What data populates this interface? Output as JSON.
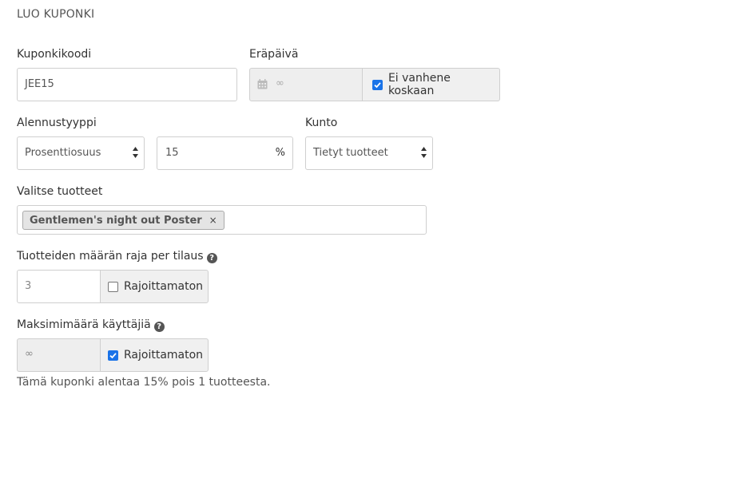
{
  "page_title": "LUO KUPONKI",
  "coupon_code": {
    "label": "Kuponkikoodi",
    "value": "JEE15"
  },
  "expiry": {
    "label": "Eräpäivä",
    "value": "∞",
    "checkbox_label": "Ei vanhene koskaan",
    "checked": true
  },
  "discount_type": {
    "label": "Alennustyyppi",
    "selected": "Prosenttiosuus",
    "amount": "15",
    "unit": "%"
  },
  "condition": {
    "label": "Kunto",
    "selected": "Tietyt tuotteet"
  },
  "products": {
    "label": "Valitse tuotteet",
    "selected_tags": [
      "Gentlemen's night out Poster"
    ],
    "remove_symbol": "×"
  },
  "quantity_limit": {
    "label": "Tuotteiden määrän raja per tilaus",
    "help_icon": "?",
    "value": "3",
    "checkbox_label": "Rajoittamaton",
    "checked": false
  },
  "max_users": {
    "label": "Maksimimäärä käyttäjiä",
    "help_icon": "?",
    "value": "∞",
    "checkbox_label": "Rajoittamaton",
    "checked": true
  },
  "summary": "Tämä kuponki alentaa 15% pois 1 tuotteesta.",
  "colors": {
    "checkbox_checked": "#1a73e8",
    "disabled_bg": "#eeeeee",
    "addon_bg": "#f0f0f0",
    "border": "#cfcfcf"
  }
}
